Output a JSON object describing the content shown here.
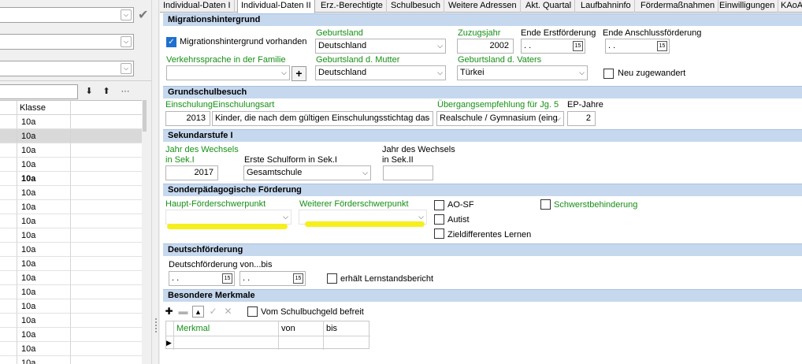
{
  "tabs": [
    "Individual-Daten I",
    "Individual-Daten II",
    "Erz.-Berechtigte",
    "Schulbesuch",
    "Weitere Adressen",
    "Akt. Quartal",
    "Laufbahninfo",
    "Fördermaßnahmen",
    "Einwilligungen",
    "KAoA"
  ],
  "left": {
    "grid_header": "Klasse",
    "rows": [
      "10a",
      "10a",
      "10a",
      "10a",
      "10a",
      "10a",
      "10a",
      "10a",
      "10a",
      "10a",
      "10a",
      "10a",
      "10a",
      "10a",
      "10a",
      "10a",
      "10a",
      "10a"
    ],
    "toolbar": {
      "down": "⬇",
      "up": "⬆",
      "more": "···"
    }
  },
  "migration": {
    "title": "Migrationshintergrund",
    "vorhanden_label": "Migrationshintergrund vorhanden",
    "geburtsland_label": "Geburtsland",
    "geburtsland": "Deutschland",
    "zuzugsjahr_label": "Zuzugsjahr",
    "zuzugsjahr": "2002",
    "ende_erst_label": "Ende Erstförderung",
    "ende_erst": " .  .",
    "ende_anschluss_label": "Ende Anschlussförderung",
    "ende_anschluss": " .  .",
    "verkehrssprache_label": "Verkehrssprache in der Familie",
    "verkehrssprache": "",
    "gb_mutter_label": "Geburtsland d. Mutter",
    "gb_mutter": "Deutschland",
    "gb_vater_label": "Geburtsland d. Vaters",
    "gb_vater": "Türkei",
    "neu_label": "Neu zugewandert",
    "plus": "+"
  },
  "grundschule": {
    "title": "Grundschulbesuch",
    "einschulung_label": "Einschulung",
    "einschulung": "2013",
    "einschulungsart_label": "Einschulungsart",
    "einschulungsart": "Kinder, die nach dem gültigen Einschulungsstichtag das",
    "empfehlung_label": "Übergangsempfehlung für Jg. 5",
    "empfehlung": "Realschule / Gymnasium (eing",
    "ep_label": "EP-Jahre",
    "ep": "2"
  },
  "sek1": {
    "title": "Sekundarstufe I",
    "wechsel1_label_a": "Jahr des Wechsels",
    "wechsel1_label_b": "in Sek.I",
    "wechsel1": "2017",
    "schulform_label": "Erste Schulform in Sek.I",
    "schulform": "Gesamtschule",
    "wechsel2_label_a": "Jahr des Wechsels",
    "wechsel2_label_b": "in Sek.II",
    "wechsel2": ""
  },
  "sonder": {
    "title": "Sonderpädagogische Förderung",
    "haupt_label": "Haupt-Förderschwerpunkt",
    "weiterer_label": "Weiterer Förderschwerpunkt",
    "aosf": "AO-SF",
    "autist": "Autist",
    "ziel": "Zieldifferentes Lernen",
    "schwerst": "Schwerstbehinderung"
  },
  "deutsch": {
    "title": "Deutschförderung",
    "label": "Deutschförderung von...bis",
    "von": " .  .",
    "bis": " .  .",
    "lernstand": "erhält Lernstandsbericht"
  },
  "merkmale": {
    "title": "Besondere Merkmale",
    "schulbuch": "Vom Schulbuchgeld befreit",
    "col_merkmal": "Merkmal",
    "col_von": "von",
    "col_bis": "bis"
  },
  "colors": {
    "section_bg": "#c6d8ee",
    "green_label": "#159015",
    "highlight": "#f6ef1e",
    "check_blue": "#1d6fd0"
  }
}
